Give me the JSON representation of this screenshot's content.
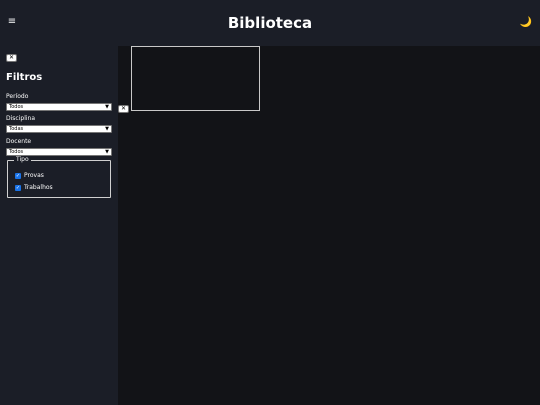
{
  "header": {
    "menu_icon": "hamburger-menu-icon",
    "menu_glyph": "≡",
    "title": "Biblioteca",
    "theme_icon": "moon-icon",
    "theme_glyph": "🌙"
  },
  "sidebar": {
    "close_glyph": "✕",
    "heading": "Filtros",
    "fields": [
      {
        "label": "Período",
        "value": "Todos"
      },
      {
        "label": "Disciplina",
        "value": "Todas"
      },
      {
        "label": "Docente",
        "value": "Todos"
      }
    ],
    "type_group": {
      "legend": "Tipo",
      "options": [
        {
          "label": "Provas",
          "checked": true
        },
        {
          "label": "Trabalhos",
          "checked": true
        }
      ]
    }
  },
  "main": {
    "close_glyph": "✕"
  },
  "colors": {
    "header_bg": "#1b1e27",
    "sidebar_bg": "#1b1e27",
    "main_bg": "#121317",
    "checkbox_accent": "#1a73e8"
  }
}
